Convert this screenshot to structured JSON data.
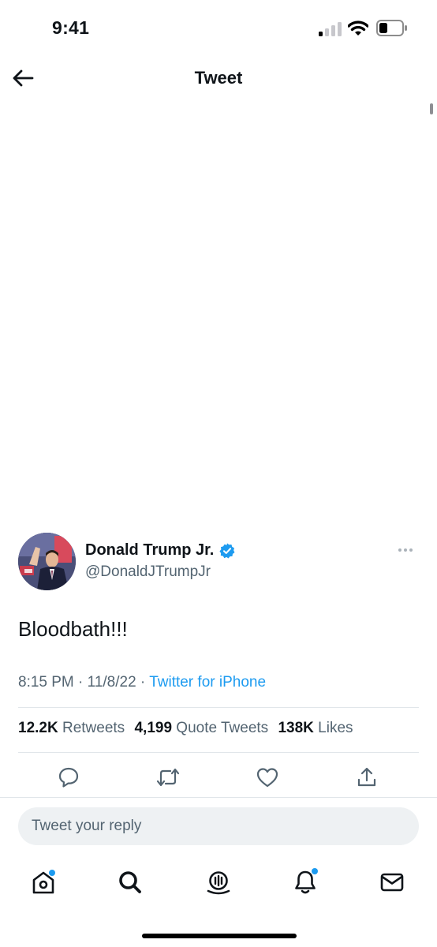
{
  "status_bar": {
    "time": "9:41",
    "signal_bars_on": 1,
    "signal_bars_total": 4,
    "battery_level": 0.3
  },
  "header": {
    "title": "Tweet",
    "back_icon": "arrow-left-icon"
  },
  "tweet": {
    "author": {
      "display_name": "Donald Trump Jr.",
      "handle": "@DonaldJTrumpJr",
      "verified": true,
      "verified_color": "#1d9bf0"
    },
    "text": "Bloodbath!!!",
    "time": "8:15 PM",
    "date": "11/8/22",
    "separator": "·",
    "source": "Twitter for iPhone",
    "stats": {
      "retweets_count": "12.2K",
      "retweets_label": "Retweets",
      "quotes_count": "4,199",
      "quotes_label": "Quote Tweets",
      "likes_count": "138K",
      "likes_label": "Likes"
    },
    "actions": [
      "reply-icon",
      "retweet-icon",
      "like-icon",
      "share-icon"
    ]
  },
  "reply": {
    "placeholder": "Tweet your reply"
  },
  "tabbar": {
    "items": [
      "home-icon",
      "search-icon",
      "spaces-icon",
      "notifications-icon",
      "messages-icon"
    ],
    "notification_dot_color": "#1d9bf0"
  },
  "colors": {
    "accent": "#1d9bf0",
    "text_primary": "#0f1419",
    "text_secondary": "#536471"
  }
}
